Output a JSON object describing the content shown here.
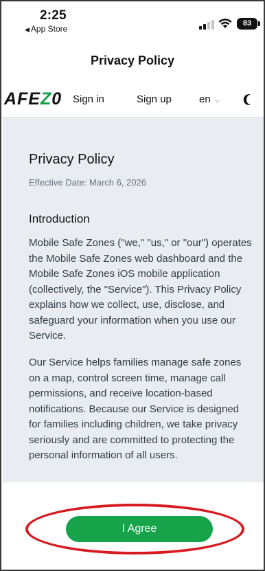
{
  "status_bar": {
    "time": "2:25",
    "back_label": "App Store",
    "battery": "83"
  },
  "header": {
    "title": "Privacy Policy"
  },
  "nav": {
    "logo_text": "AFE",
    "logo_accent": "Z",
    "logo_tail": "0",
    "sign_in": "Sign in",
    "sign_up": "Sign up",
    "language": "en"
  },
  "content": {
    "heading": "Privacy Policy",
    "effective_date": "Effective Date: March 6, 2026",
    "section_title": "Introduction",
    "paragraph1": "Mobile Safe Zones (\"we,\" \"us,\" or \"our\") operates the Mobile Safe Zones web dashboard and the Mobile Safe Zones iOS mobile application (collectively, the \"Service\"). This Privacy Policy explains how we collect, use, disclose, and safeguard your information when you use our Service.",
    "paragraph2": "Our Service helps families manage safe zones on a map, control screen time, manage call permissions, and receive location-based notifications. Because our Service is designed for families including children, we take privacy seriously and are committed to protecting the personal information of all users."
  },
  "footer": {
    "agree_label": "I Agree"
  },
  "colors": {
    "accent_green": "#16a34a",
    "highlight_red": "#d71920",
    "panel_bg": "#e9edf2"
  }
}
